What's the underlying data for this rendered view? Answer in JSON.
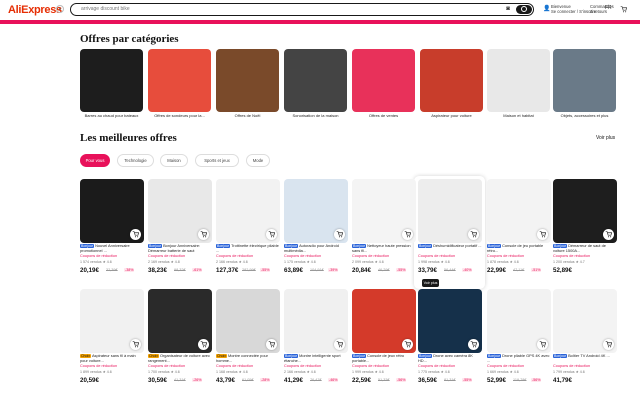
{
  "header": {
    "logo": "AliExpress",
    "search_placeholder": "arrivage discount bike",
    "account_l1": "Bienvenue",
    "account_l2": "Se connecter / S'inscrire",
    "orders_label": "Commandes",
    "orders_sub": "& retours",
    "language": "FR"
  },
  "categories_title": "Offres par catégories",
  "categories": [
    {
      "label": "Barres au chaud pour bateaux",
      "color": "#1d1d1d"
    },
    {
      "label": "Offres de sondeurs pour la...",
      "color": "#e74d3c"
    },
    {
      "label": "Offres de Noël",
      "color": "#7a4a2a"
    },
    {
      "label": "Sonorisation de la maison",
      "color": "#444444"
    },
    {
      "label": "Offres de ventes",
      "color": "#e8315a"
    },
    {
      "label": "Aspirateur pour voiture",
      "color": "#c83d2b"
    },
    {
      "label": "Maison et habitat",
      "color": "#e8e8e8"
    },
    {
      "label": "Objets, accessoires et plus",
      "color": "#6a7a88"
    }
  ],
  "best_title": "Les meilleures offres",
  "see_more": "Voir plus",
  "tabs": [
    "Pour vous",
    "Technologie",
    "Maison",
    "Sports et jeux",
    "Mode"
  ],
  "tooltip": "Voir plus",
  "products_row1": [
    {
      "title": "Nouvel Anniversaire promotionnel ...",
      "badge": "Bonjour",
      "coupon": "Coupons de réduction",
      "sold": "1 574 vendus ★ 4.6",
      "price": "20,19€",
      "old": "32,39€",
      "disc": "-38%",
      "color": "#1b1b1b"
    },
    {
      "title": "Bonjour Anniversaire: Démarreur batterie de saut portable...",
      "badge": "Bonjour",
      "coupon": "Coupons de réduction",
      "sold": "2 169 vendus ★ 4.8",
      "price": "38,23€",
      "old": "98,32€",
      "disc": "-61%",
      "color": "#e8e8e8"
    },
    {
      "title": "Trottinette électrique pliable ...",
      "badge": "Bonjour",
      "coupon": "Coupons de réduction",
      "sold": "2 166 vendus ★ 4.6",
      "price": "127,37€",
      "old": "282,99€",
      "disc": "-55%",
      "color": "#f2f2f2"
    },
    {
      "title": "Autoradio pour Android multimédia...",
      "badge": "Bonjour",
      "coupon": "Coupons de réduction",
      "sold": "1 175 vendus ★ 4.6",
      "price": "63,89€",
      "old": "104,91€",
      "disc": "-39%",
      "color": "#d9e4ef"
    },
    {
      "title": "Nettoyeur haute pression sans fil...",
      "badge": "Bonjour",
      "coupon": "Coupons de réduction",
      "sold": "2 099 vendus ★ 4.6",
      "price": "20,84€",
      "old": "46,29€",
      "disc": "-55%",
      "color": "#f4f4f4"
    },
    {
      "title": "Déshumidificateur portatif ...",
      "badge": "Bonjour",
      "coupon": "Coupons de réduction",
      "sold": "1 998 vendus ★ 4.6",
      "price": "33,79€",
      "old": "56,44€",
      "disc": "-40%",
      "color": "#ededed"
    },
    {
      "title": "Console de jeu portable rétro...",
      "badge": "Bonjour",
      "coupon": "Coupons de réduction",
      "sold": "1 878 vendus ★ 4.6",
      "price": "22,99€",
      "old": "47,11€",
      "disc": "-51%",
      "color": "#f3f3f3"
    },
    {
      "title": "Démarreur de saut de voiture 1500A...",
      "badge": "Bonjour",
      "coupon": "Coupons de réduction",
      "sold": "1 200 vendus ★ 4.7",
      "price": "52,89€",
      "old": "",
      "disc": "",
      "color": "#1e1e1e"
    }
  ],
  "products_row2": [
    {
      "title": "Aspirateur sans fil à main pour voiture...",
      "badge": "Choix",
      "coupon": "Coupons de réduction",
      "sold": "1 899 vendus ★ 4.6",
      "price": "20,59€",
      "old": "",
      "disc": "",
      "color": "#f1f1f1"
    },
    {
      "title": "Organisateur de voiture avec rangement...",
      "badge": "Choix",
      "coupon": "Coupons de réduction",
      "sold": "1 700 vendus ★ 4.6",
      "price": "30,59€",
      "old": "41,31€",
      "disc": "-26%",
      "color": "#2a2a2a"
    },
    {
      "title": "Montre connectée pour homme...",
      "badge": "Choix",
      "coupon": "Coupons de réduction",
      "sold": "1 168 vendus ★ 4.6",
      "price": "43,79€",
      "old": "61,05€",
      "disc": "-28%",
      "color": "#d8d8d8"
    },
    {
      "title": "Montre intelligente sport étanche...",
      "badge": "Bonjour",
      "coupon": "Coupons de réduction",
      "sold": "2 166 vendus ★ 4.6",
      "price": "41,29€",
      "old": "76,47€",
      "disc": "-46%",
      "color": "#f0f0f0"
    },
    {
      "title": "Console de jeux rétro portable...",
      "badge": "Bonjour",
      "coupon": "Coupons de réduction",
      "sold": "1 999 vendus ★ 4.6",
      "price": "22,59€",
      "old": "51,33€",
      "disc": "-56%",
      "color": "#d43a2a"
    },
    {
      "title": "Drone avec caméra 8K HD...",
      "badge": "Bonjour",
      "coupon": "Coupons de réduction",
      "sold": "1 775 vendus ★ 4.6",
      "price": "36,59€",
      "old": "81,31€",
      "disc": "-55%",
      "color": "#15304a"
    },
    {
      "title": "Drone pliable GPS 4K avec ...",
      "badge": "Bonjour",
      "coupon": "Coupons de réduction",
      "sold": "1 669 vendus ★ 4.6",
      "price": "52,99€",
      "old": "119,78€",
      "disc": "-56%",
      "color": "#f2f2f2"
    },
    {
      "title": "Boîtier TV Android 4K ...",
      "badge": "Bonjour",
      "coupon": "Coupons de réduction",
      "sold": "1 799 vendus ★ 4.6",
      "price": "41,79€",
      "old": "",
      "disc": "",
      "color": "#f3f3f3"
    }
  ]
}
